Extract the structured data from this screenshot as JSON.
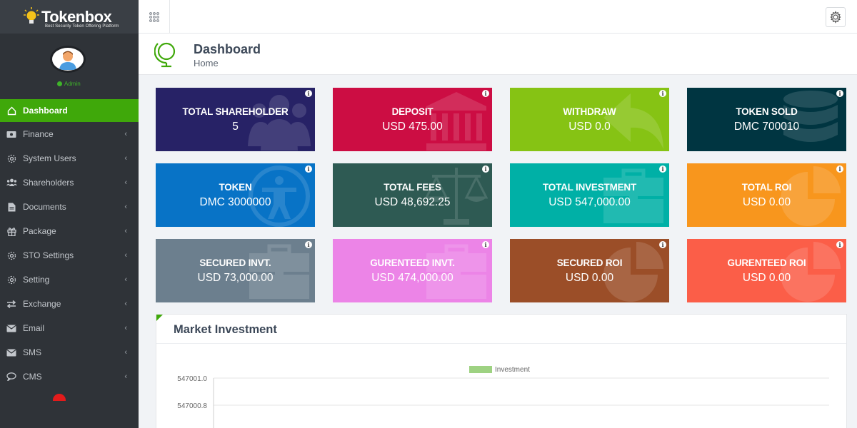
{
  "brand": {
    "name_prefix": "Token",
    "name_suffix": "box",
    "tagline": "Best Security Token Offering Platform"
  },
  "profile": {
    "role": "Admin"
  },
  "sidebar": {
    "items": [
      {
        "label": "Dashboard",
        "icon": "home-icon",
        "active": true
      },
      {
        "label": "Finance",
        "icon": "money-icon"
      },
      {
        "label": "System Users",
        "icon": "gear-icon"
      },
      {
        "label": "Shareholders",
        "icon": "users-icon"
      },
      {
        "label": "Documents",
        "icon": "document-icon"
      },
      {
        "label": "Package",
        "icon": "gift-icon"
      },
      {
        "label": "STO Settings",
        "icon": "gear-icon"
      },
      {
        "label": "Setting",
        "icon": "gear-icon"
      },
      {
        "label": "Exchange",
        "icon": "exchange-icon"
      },
      {
        "label": "Email",
        "icon": "envelope-icon"
      },
      {
        "label": "SMS",
        "icon": "envelope-icon"
      },
      {
        "label": "CMS",
        "icon": "chat-icon"
      }
    ],
    "chevron": "‹"
  },
  "page": {
    "title": "Dashboard",
    "breadcrumb": "Home"
  },
  "cards": [
    {
      "label": "TOTAL SHAREHOLDER",
      "value": "5",
      "color": "#272266",
      "icon": "users-icon"
    },
    {
      "label": "DEPOSIT",
      "value": "USD 475.00",
      "color": "#cc0d43",
      "icon": "bank-icon"
    },
    {
      "label": "WITHDRAW",
      "value": "USD 0.0",
      "color": "#86c314",
      "icon": "reply-icon"
    },
    {
      "label": "TOKEN SOLD",
      "value": "DMC 700010",
      "color": "#003541",
      "icon": "database-icon"
    },
    {
      "label": "TOKEN",
      "value": "DMC 3000000",
      "color": "#0873c6",
      "icon": "accessibility-icon"
    },
    {
      "label": "TOTAL FEES",
      "value": "USD 48,692.25",
      "color": "#2e5a53",
      "icon": "scale-icon"
    },
    {
      "label": "TOTAL INVESTMENT",
      "value": "USD 547,000.00",
      "color": "#00b0a6",
      "icon": "briefcase-icon"
    },
    {
      "label": "TOTAL ROI",
      "value": "USD 0.00",
      "color": "#f8961d",
      "icon": "pie-chart-icon"
    },
    {
      "label": "SECURED INVT.",
      "value": "USD 73,000.00",
      "color": "#6c7f8e",
      "icon": "briefcase-icon"
    },
    {
      "label": "GURENTEED INVT.",
      "value": "USD 474,000.00",
      "color": "#ec84e7",
      "icon": "briefcase-icon"
    },
    {
      "label": "SECURED ROI",
      "value": "USD 0.00",
      "color": "#9b4e28",
      "icon": "pie-chart-icon"
    },
    {
      "label": "GURENTEED ROI",
      "value": "USD 0.00",
      "color": "#fb5e48",
      "icon": "pie-chart-icon"
    }
  ],
  "panel": {
    "title": "Market Investment"
  },
  "chart_data": {
    "type": "bar",
    "title": "",
    "series": [
      {
        "name": "Investment",
        "values": []
      }
    ],
    "legend": "top",
    "legend_color": "#9ed282",
    "ytick_labels": [
      "547001.0",
      "547000.8"
    ],
    "grid": true
  }
}
